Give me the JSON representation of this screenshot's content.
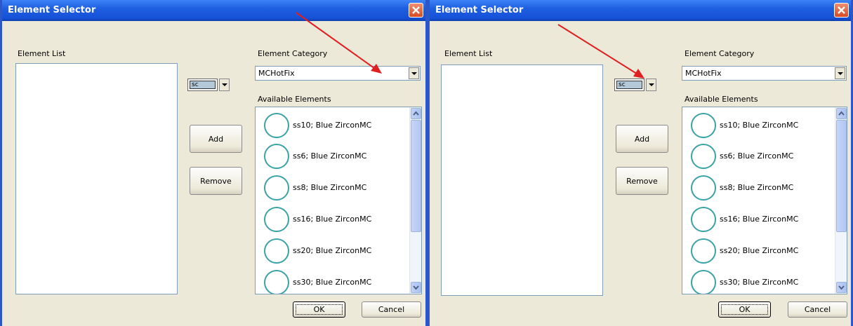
{
  "left": {
    "title": "Element Selector",
    "element_list_label": "Element List",
    "element_category_label": "Element Category",
    "category_value": "MCHotFix",
    "sc_value": "sc",
    "available_label": "Available Elements",
    "add_label": "Add",
    "remove_label": "Remove",
    "ok_label": "OK",
    "cancel_label": "Cancel",
    "items": [
      "ss10; Blue ZirconMC",
      "ss6; Blue ZirconMC",
      "ss8; Blue ZirconMC",
      "ss16; Blue ZirconMC",
      "ss20; Blue ZirconMC",
      "ss30; Blue ZirconMC"
    ]
  },
  "right": {
    "title": "Element Selector",
    "element_list_label": "Element List",
    "element_category_label": "Element Category",
    "category_value": "MCHotFix",
    "sc_value": "sc",
    "available_label": "Available Elements",
    "add_label": "Add",
    "remove_label": "Remove",
    "ok_label": "OK",
    "cancel_label": "Cancel",
    "items": [
      "ss10; Blue ZirconMC",
      "ss6; Blue ZirconMC",
      "ss8; Blue ZirconMC",
      "ss16; Blue ZirconMC",
      "ss20; Blue ZirconMC",
      "ss30; Blue ZirconMC"
    ]
  },
  "colors": {
    "titlebar": "#1e5ee0",
    "circle": "#3ba3a5",
    "annotation_arrow": "#e02020"
  },
  "icons": {
    "close": "close-icon",
    "dropdown": "chevron-down-icon",
    "annotation": "red-arrow-annotation"
  }
}
